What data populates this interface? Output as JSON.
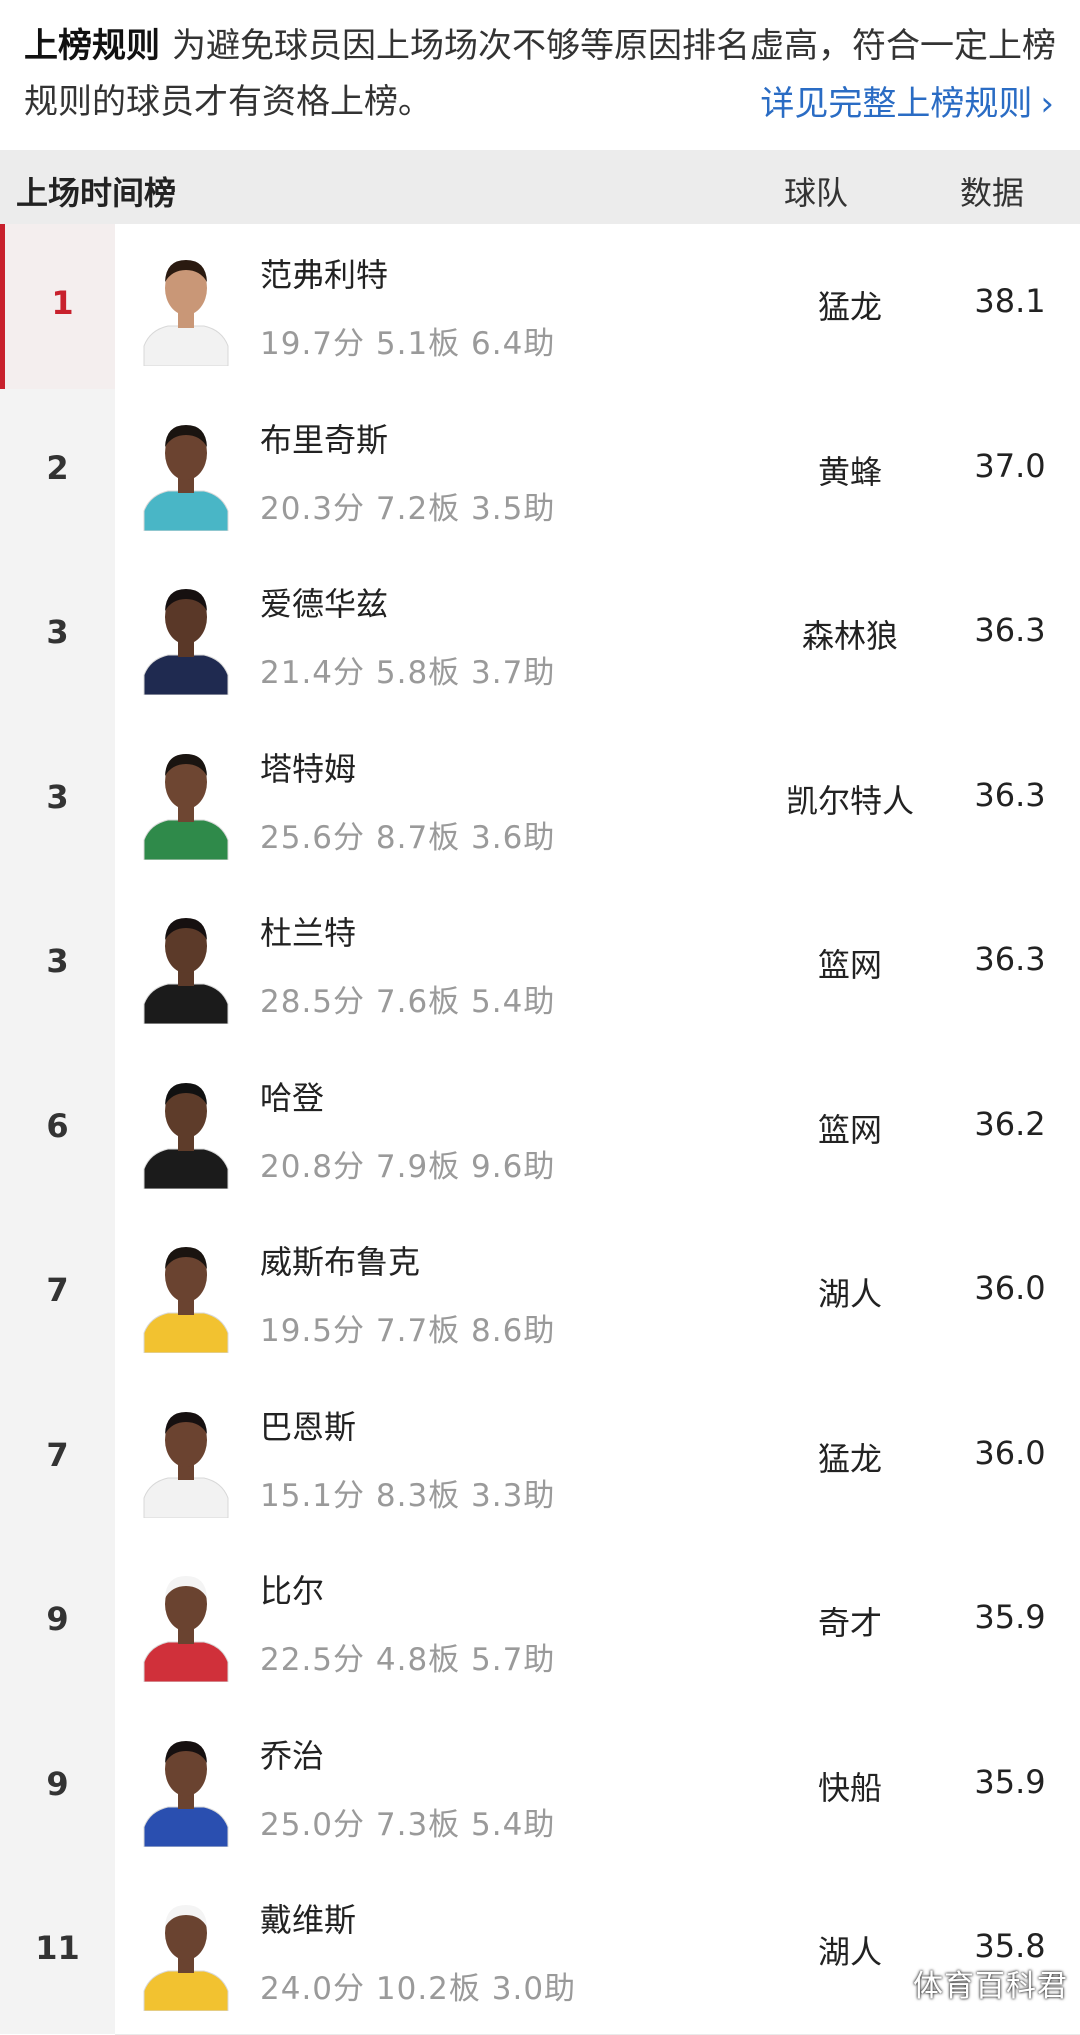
{
  "rules": {
    "title": "上榜规则",
    "text": "为避免球员因上场场次不够等原因排名虚高，符合一定上榜规则的球员才有资格上榜。",
    "link_label": "详见完整上榜规则",
    "link_chevron": "›"
  },
  "header": {
    "title": "上场时间榜",
    "team_col": "球队",
    "data_col": "数据"
  },
  "players": [
    {
      "rank": "1",
      "name": "范弗利特",
      "stats": "19.7分  5.1板  6.4助",
      "team": "猛龙",
      "value": "38.1",
      "jersey": "#f2f2f2",
      "skin": "#c99777",
      "hair": "#2a1a10"
    },
    {
      "rank": "2",
      "name": "布里奇斯",
      "stats": "20.3分  7.2板  3.5助",
      "team": "黄蜂",
      "value": "37.0",
      "jersey": "#49b6c6",
      "skin": "#6b4330",
      "hair": "#1a1410"
    },
    {
      "rank": "3",
      "name": "爱德华兹",
      "stats": "21.4分  5.8板  3.7助",
      "team": "森林狼",
      "value": "36.3",
      "jersey": "#1f2a50",
      "skin": "#5a3828",
      "hair": "#161010"
    },
    {
      "rank": "3",
      "name": "塔特姆",
      "stats": "25.6分  8.7板  3.6助",
      "team": "凯尔特人",
      "value": "36.3",
      "jersey": "#2f8a4a",
      "skin": "#6e4632",
      "hair": "#1a1410"
    },
    {
      "rank": "3",
      "name": "杜兰特",
      "stats": "28.5分  7.6板  5.4助",
      "team": "篮网",
      "value": "36.3",
      "jersey": "#1b1b1b",
      "skin": "#5c3a29",
      "hair": "#161010"
    },
    {
      "rank": "6",
      "name": "哈登",
      "stats": "20.8分  7.9板  9.6助",
      "team": "篮网",
      "value": "36.2",
      "jersey": "#1b1b1b",
      "skin": "#5e3c2a",
      "hair": "#111111"
    },
    {
      "rank": "7",
      "name": "威斯布鲁克",
      "stats": "19.5分  7.7板  8.6助",
      "team": "湖人",
      "value": "36.0",
      "jersey": "#f2c230",
      "skin": "#6a4330",
      "hair": "#1a1410"
    },
    {
      "rank": "7",
      "name": "巴恩斯",
      "stats": "15.1分  8.3板  3.3助",
      "team": "猛龙",
      "value": "36.0",
      "jersey": "#f2f2f2",
      "skin": "#6b4330",
      "hair": "#161010"
    },
    {
      "rank": "9",
      "name": "比尔",
      "stats": "22.5分  4.8板  5.7助",
      "team": "奇才",
      "value": "35.9",
      "jersey": "#d0303a",
      "skin": "#6a4330",
      "hair": "#f4f4f4"
    },
    {
      "rank": "9",
      "name": "乔治",
      "stats": "25.0分  7.3板  5.4助",
      "team": "快船",
      "value": "35.9",
      "jersey": "#2a4fb0",
      "skin": "#6a4330",
      "hair": "#161010"
    },
    {
      "rank": "11",
      "name": "戴维斯",
      "stats": "24.0分  10.2板  3.0助",
      "team": "湖人",
      "value": "35.8",
      "jersey": "#f2c230",
      "skin": "#6a4330",
      "hair": "#f4f4f4"
    }
  ],
  "watermark": "体育百科君"
}
